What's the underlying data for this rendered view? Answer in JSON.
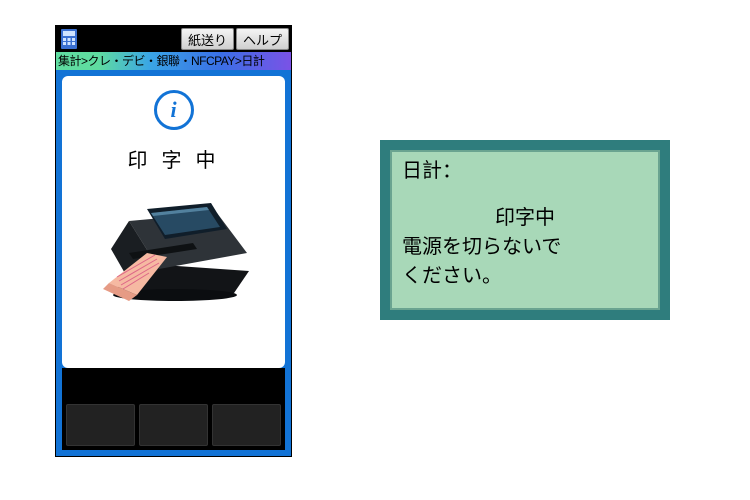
{
  "device": {
    "topbar": {
      "icon": "calculator-icon",
      "buttons": {
        "paper_feed": "紙送り",
        "help": "ヘルプ"
      }
    },
    "breadcrumb": "集計>クレ・デビ・銀聯・NFCPAY>日計",
    "panel": {
      "info_icon": "info-icon",
      "status_text": "印字中",
      "illustration": "receipt-printer"
    }
  },
  "lcd": {
    "title": "日計：",
    "status": "印字中",
    "warning_line1": "電源を切らないで",
    "warning_line2": "ください。"
  }
}
